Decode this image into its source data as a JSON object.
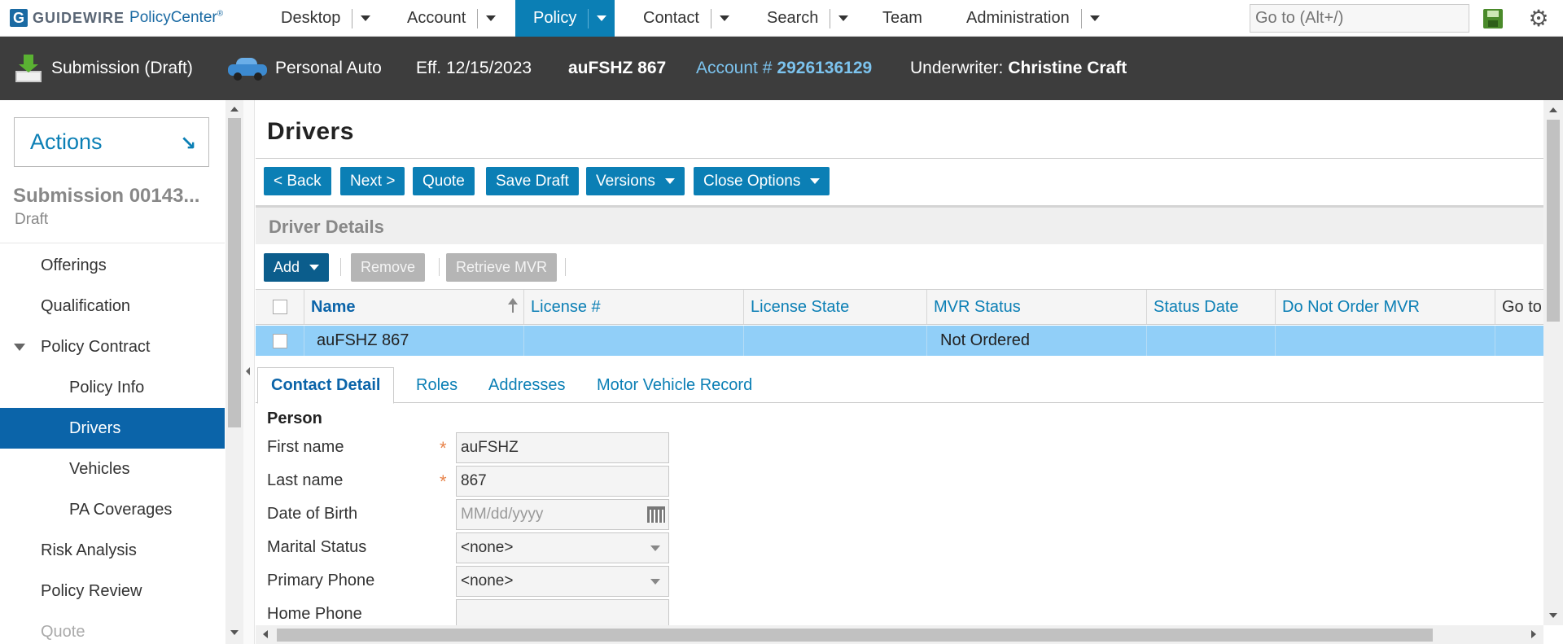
{
  "topnav": {
    "logo_word": "GUIDEWIRE",
    "logo_product": "PolicyCenter",
    "logo_reg": "®",
    "tabs": [
      {
        "label": "Desktop"
      },
      {
        "label": "Account"
      },
      {
        "label": "Policy",
        "active": true
      },
      {
        "label": "Contact"
      },
      {
        "label": "Search"
      },
      {
        "label": "Team"
      },
      {
        "label": "Administration"
      }
    ],
    "goto_placeholder": "Go to (Alt+/)",
    "icons": [
      "save-icon",
      "gear-icon"
    ]
  },
  "infobar": {
    "submission": "Submission (Draft)",
    "product": "Personal Auto",
    "effective": "Eff. 12/15/2023",
    "insured": "auFSHZ 867",
    "account_label": "Account #",
    "account_number": "2926136129",
    "underwriter_label": "Underwriter:",
    "underwriter_name": "Christine Craft"
  },
  "sidebar": {
    "actions_label": "Actions",
    "submission_title": "Submission 00143...",
    "submission_status": "Draft",
    "items": [
      {
        "label": "Offerings"
      },
      {
        "label": "Qualification"
      },
      {
        "label": "Policy Contract",
        "expanded": true
      },
      {
        "label": "Policy Info"
      },
      {
        "label": "Drivers",
        "active": true
      },
      {
        "label": "Vehicles"
      },
      {
        "label": "PA Coverages"
      },
      {
        "label": "Risk Analysis"
      },
      {
        "label": "Policy Review"
      },
      {
        "label": "Quote",
        "disabled": true
      }
    ]
  },
  "main": {
    "title": "Drivers",
    "toolbar": {
      "back": "< Back",
      "next": "Next >",
      "quote": "Quote",
      "save_draft": "Save Draft",
      "versions": "Versions",
      "close_options": "Close Options"
    },
    "section_title": "Driver Details",
    "list_buttons": {
      "add": "Add",
      "remove": "Remove",
      "retrieve_mvr": "Retrieve MVR"
    },
    "columns": [
      "Name",
      "License #",
      "License State",
      "MVR Status",
      "Status Date",
      "Do Not Order MVR",
      "Go to"
    ],
    "rows": [
      {
        "name": "auFSHZ 867",
        "license": "",
        "license_state": "",
        "mvr_status": "Not Ordered",
        "status_date": "",
        "do_not_order": "",
        "goto": ""
      }
    ],
    "tabs": [
      {
        "label": "Contact Detail",
        "active": true
      },
      {
        "label": "Roles"
      },
      {
        "label": "Addresses"
      },
      {
        "label": "Motor Vehicle Record"
      }
    ],
    "person_label": "Person",
    "fields": {
      "first_name": {
        "label": "First name",
        "value": "auFSHZ",
        "required": true
      },
      "last_name": {
        "label": "Last name",
        "value": "867",
        "required": true
      },
      "dob": {
        "label": "Date of Birth",
        "placeholder": "MM/dd/yyyy"
      },
      "marital": {
        "label": "Marital Status",
        "value": "<none>"
      },
      "primary_phone": {
        "label": "Primary Phone",
        "value": "<none>"
      },
      "home_phone": {
        "label": "Home Phone",
        "value": ""
      }
    },
    "required_mark": "*"
  },
  "colors": {
    "accent": "#0b7fb5",
    "active_nav": "#0b64a9",
    "selected_row": "#91cff8",
    "infobar_bg": "#3d3d3d",
    "link_light": "#7cc3ee"
  }
}
